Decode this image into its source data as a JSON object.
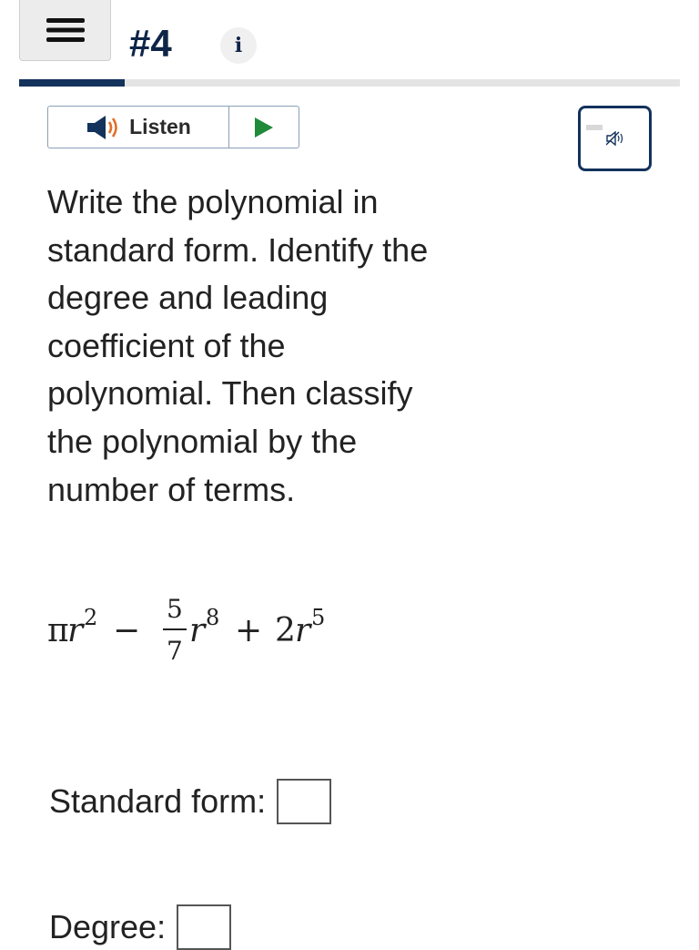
{
  "header": {
    "title": "#4",
    "info_glyph": "i",
    "progress_percent": 16
  },
  "listen": {
    "label": "Listen",
    "icon": "speaker-icon",
    "play_icon": "play-icon"
  },
  "mute_icon": "speaker-mute-icon",
  "question": {
    "text": "Write the polynomial in standard form. Identify the degree and leading coefficient of the polynomial. Then classify the polynomial by the number of terms."
  },
  "expression": {
    "term1_coef": "π",
    "term1_var": "r",
    "term1_exp": "2",
    "op1": "−",
    "frac_num": "5",
    "frac_den": "7",
    "term2_var": "r",
    "term2_exp": "8",
    "op2": "+",
    "term3_coef": "2",
    "term3_var": "r",
    "term3_exp": "5"
  },
  "fields": {
    "standard_form_label": "Standard form:",
    "degree_label": "Degree:"
  },
  "colors": {
    "navy": "#13325c",
    "speaker_orange": "#e0702a",
    "play_green": "#1f8a3a"
  }
}
